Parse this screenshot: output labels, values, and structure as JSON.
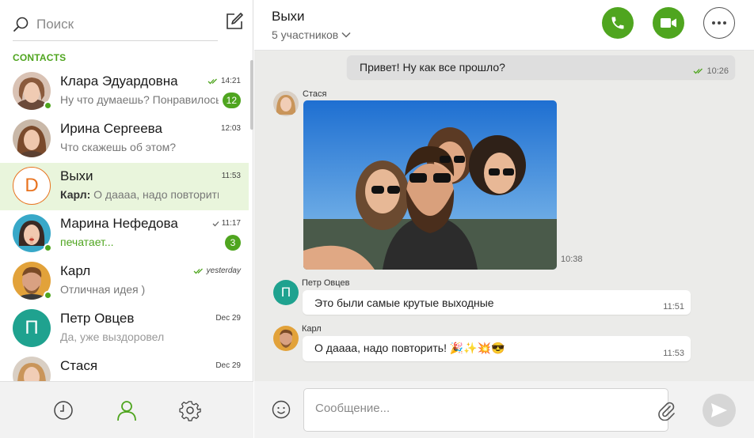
{
  "colors": {
    "accent": "#4fa51f",
    "active_row": "#e9f5dc",
    "chat_bg": "#ebebe9"
  },
  "search": {
    "placeholder": "Поиск"
  },
  "sidebar": {
    "section_label": "CONTACTS",
    "chats": [
      {
        "name": "Клара Эдуардовна",
        "preview": "Ну что думаешь? Понравилось?",
        "time": "14:21",
        "read": true,
        "badge": "12",
        "online": true
      },
      {
        "name": "Ирина Сергеева",
        "preview": "Что скажешь об этом?",
        "time": "12:03",
        "online": false
      },
      {
        "name": "Выхи",
        "avatar_letter": "D",
        "preview_sender": "Карл:",
        "preview": "О даааа, надо повторить!",
        "time": "11:53",
        "active": true
      },
      {
        "name": "Марина Нефедова",
        "preview": "печатает...",
        "time": "11:17",
        "read": true,
        "badge": "3",
        "online": true
      },
      {
        "name": "Карл",
        "preview": "Отличная идея )",
        "time": "yesterday",
        "read": true,
        "online": true
      },
      {
        "name": "Петр Овцев",
        "avatar_letter": "П",
        "preview": "Да, уже выздоровел",
        "time": "Dec 29"
      },
      {
        "name": "Стася",
        "preview": "",
        "time": "Dec 29"
      }
    ]
  },
  "nav": {
    "icons": [
      "clock-icon",
      "contacts-icon",
      "settings-icon"
    ]
  },
  "chat": {
    "title": "Выхи",
    "subtitle": "5 участников",
    "messages": [
      {
        "text": "Привет! Ну как все прошло?",
        "time": "10:26",
        "outgoing": true
      },
      {
        "sender": "Стася",
        "type": "photo",
        "time": "10:38"
      },
      {
        "sender": "Петр Овцев",
        "avatar_letter": "П",
        "text": "Это были самые крутые выходные",
        "time": "11:51"
      },
      {
        "sender": "Карл",
        "text": "О даааа, надо повторить! 🎉✨💥😎",
        "time": "11:53"
      }
    ]
  },
  "composer": {
    "placeholder": "Сообщение..."
  }
}
